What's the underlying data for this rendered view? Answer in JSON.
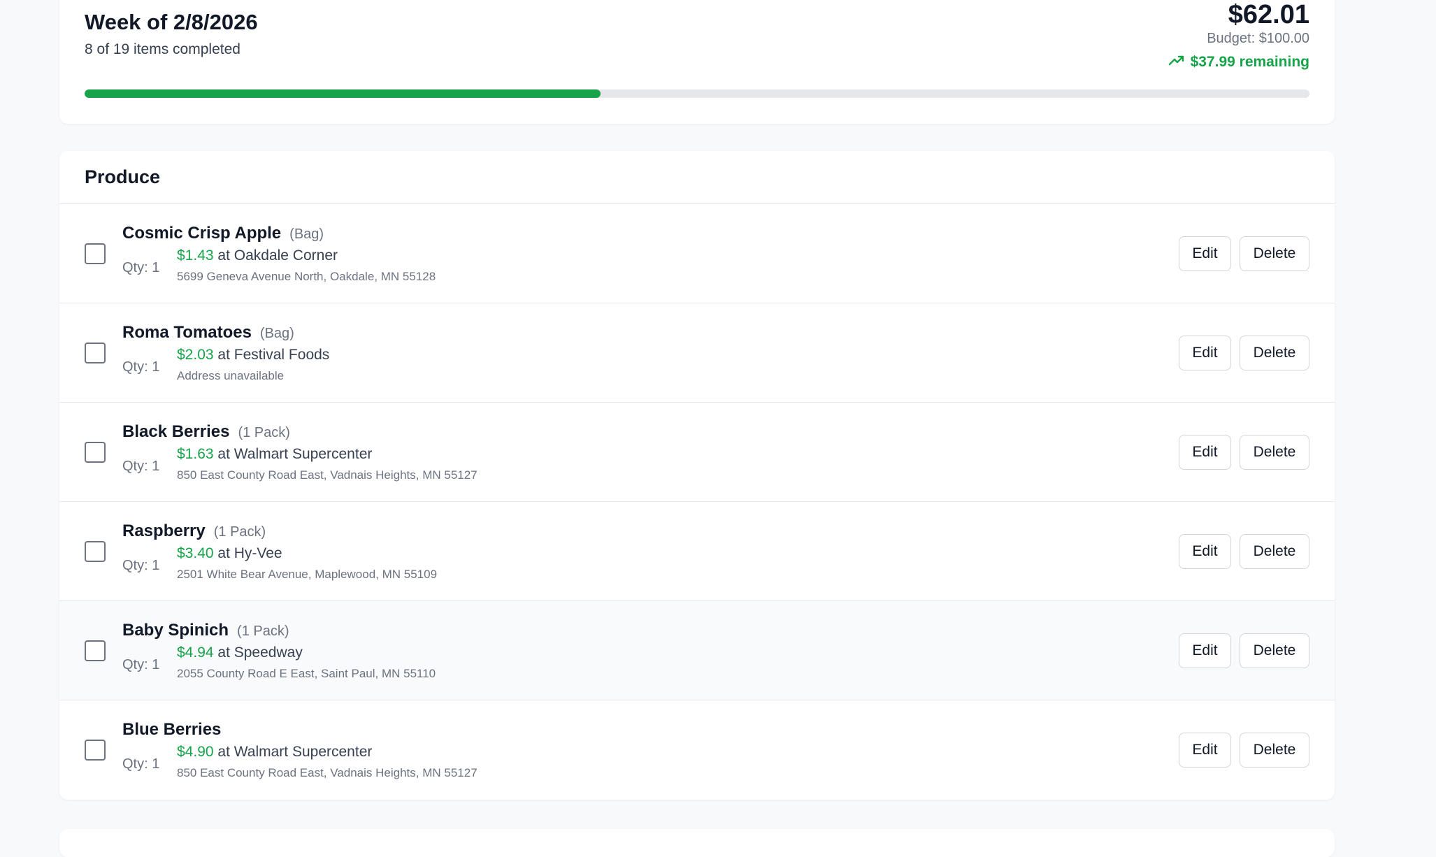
{
  "summary": {
    "week_title": "Week of 2/8/2026",
    "progress_text": "8 of 19 items completed",
    "total": "$62.01",
    "budget": "Budget: $100.00",
    "remaining": "$37.99 remaining",
    "completed_count": 8,
    "total_count": 19,
    "progress_fraction": 0.421,
    "icons": {
      "remaining": "trending-up-icon"
    },
    "colors": {
      "accent_green": "#16a34a",
      "track_gray": "#e5e7eb"
    }
  },
  "produce": {
    "title": "Produce",
    "items": [
      {
        "name": "Cosmic Crisp Apple",
        "unit": "(Bag)",
        "qty": "Qty: 1",
        "price": "$1.43",
        "store": " at Oakdale Corner",
        "address": "5699 Geneva Avenue North, Oakdale, MN 55128",
        "edit_label": "Edit",
        "delete_label": "Delete",
        "checked": false
      },
      {
        "name": "Roma Tomatoes",
        "unit": "(Bag)",
        "qty": "Qty: 1",
        "price": "$2.03",
        "store": " at Festival Foods",
        "address": "Address unavailable",
        "edit_label": "Edit",
        "delete_label": "Delete",
        "checked": false
      },
      {
        "name": "Black Berries",
        "unit": "(1 Pack)",
        "qty": "Qty: 1",
        "price": "$1.63",
        "store": " at Walmart Supercenter",
        "address": "850 East County Road East, Vadnais Heights, MN 55127",
        "edit_label": "Edit",
        "delete_label": "Delete",
        "checked": false
      },
      {
        "name": "Raspberry",
        "unit": "(1 Pack)",
        "qty": "Qty: 1",
        "price": "$3.40",
        "store": " at Hy-Vee",
        "address": "2501 White Bear Avenue, Maplewood, MN 55109",
        "edit_label": "Edit",
        "delete_label": "Delete",
        "checked": false
      },
      {
        "name": "Baby Spinich",
        "unit": "(1 Pack)",
        "qty": "Qty: 1",
        "price": "$4.94",
        "store": " at Speedway",
        "address": "2055 County Road E East, Saint Paul, MN 55110",
        "edit_label": "Edit",
        "delete_label": "Delete",
        "checked": false
      },
      {
        "name": "Blue Berries",
        "unit": "",
        "qty": "Qty: 1",
        "price": "$4.90",
        "store": " at Walmart Supercenter",
        "address": "850 East County Road East, Vadnais Heights, MN 55127",
        "edit_label": "Edit",
        "delete_label": "Delete",
        "checked": false
      }
    ]
  }
}
